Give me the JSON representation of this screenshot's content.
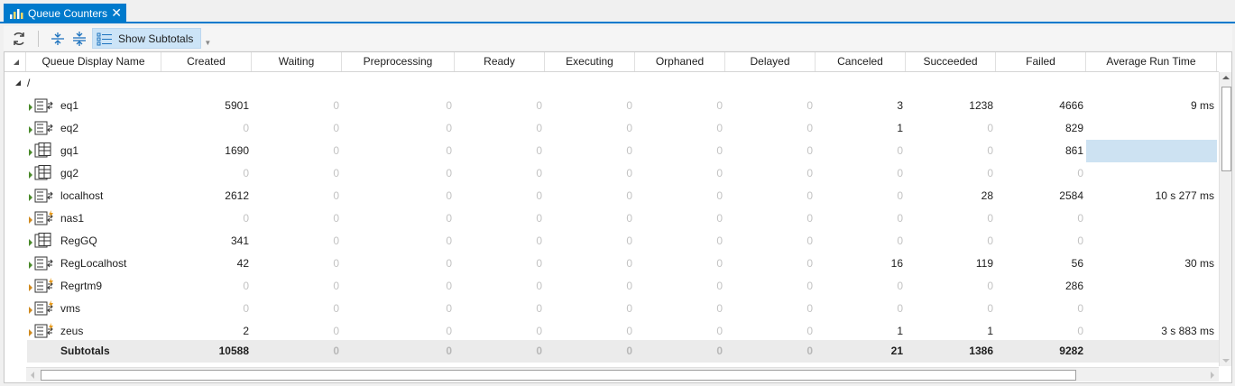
{
  "tab": {
    "title": "Queue Counters",
    "icon": "bar-chart-icon",
    "close_icon": "close-icon"
  },
  "toolbar": {
    "refresh_icon": "refresh-icon",
    "expand_all_icon": "expand-all-icon",
    "collapse_all_icon": "collapse-all-icon",
    "show_subtotals_label": "Show Subtotals",
    "show_subtotals_active": true
  },
  "columns": [
    "Queue Display Name",
    "Created",
    "Waiting",
    "Preprocessing",
    "Ready",
    "Executing",
    "Orphaned",
    "Delayed",
    "Canceled",
    "Succeeded",
    "Failed",
    "Average Run Time"
  ],
  "group": {
    "label": "/"
  },
  "rows": [
    {
      "name": "eq1",
      "type": "execution-queue",
      "values": [
        "5901",
        "0",
        "0",
        "0",
        "0",
        "0",
        "0",
        "3",
        "1238",
        "4666"
      ],
      "avg": "9 ms"
    },
    {
      "name": "eq2",
      "type": "execution-queue",
      "values": [
        "0",
        "0",
        "0",
        "0",
        "0",
        "0",
        "0",
        "1",
        "0",
        "829"
      ],
      "avg": ""
    },
    {
      "name": "gq1",
      "type": "grid-queue",
      "values": [
        "1690",
        "0",
        "0",
        "0",
        "0",
        "0",
        "0",
        "0",
        "0",
        "861"
      ],
      "avg": ""
    },
    {
      "name": "gq2",
      "type": "grid-queue",
      "values": [
        "0",
        "0",
        "0",
        "0",
        "0",
        "0",
        "0",
        "0",
        "0",
        "0"
      ],
      "avg": ""
    },
    {
      "name": "localhost",
      "type": "execution-queue",
      "values": [
        "2612",
        "0",
        "0",
        "0",
        "0",
        "0",
        "0",
        "0",
        "28",
        "2584"
      ],
      "avg": "10 s 277 ms"
    },
    {
      "name": "nas1",
      "type": "warning-queue",
      "values": [
        "0",
        "0",
        "0",
        "0",
        "0",
        "0",
        "0",
        "0",
        "0",
        "0"
      ],
      "avg": ""
    },
    {
      "name": "RegGQ",
      "type": "grid-queue",
      "values": [
        "341",
        "0",
        "0",
        "0",
        "0",
        "0",
        "0",
        "0",
        "0",
        "0"
      ],
      "avg": ""
    },
    {
      "name": "RegLocalhost",
      "type": "execution-queue",
      "values": [
        "42",
        "0",
        "0",
        "0",
        "0",
        "0",
        "0",
        "16",
        "119",
        "56"
      ],
      "avg": "30 ms"
    },
    {
      "name": "Regrtm9",
      "type": "warning-queue",
      "values": [
        "0",
        "0",
        "0",
        "0",
        "0",
        "0",
        "0",
        "0",
        "0",
        "286"
      ],
      "avg": ""
    },
    {
      "name": "vms",
      "type": "warning-queue",
      "values": [
        "0",
        "0",
        "0",
        "0",
        "0",
        "0",
        "0",
        "0",
        "0",
        "0"
      ],
      "avg": ""
    },
    {
      "name": "zeus",
      "type": "warning-queue",
      "values": [
        "2",
        "0",
        "0",
        "0",
        "0",
        "0",
        "0",
        "1",
        "1",
        "0"
      ],
      "avg": "3 s 883 ms"
    }
  ],
  "subtotals": {
    "label": "Subtotals",
    "values": [
      "10588",
      "0",
      "0",
      "0",
      "0",
      "0",
      "0",
      "21",
      "1386",
      "9282"
    ]
  },
  "colors": {
    "accent": "#007acc",
    "selection": "#cde2f2",
    "subtotal_bg": "#ebebeb",
    "zero_text": "#c3c3c3",
    "toggle_active": "#cce4f7"
  }
}
